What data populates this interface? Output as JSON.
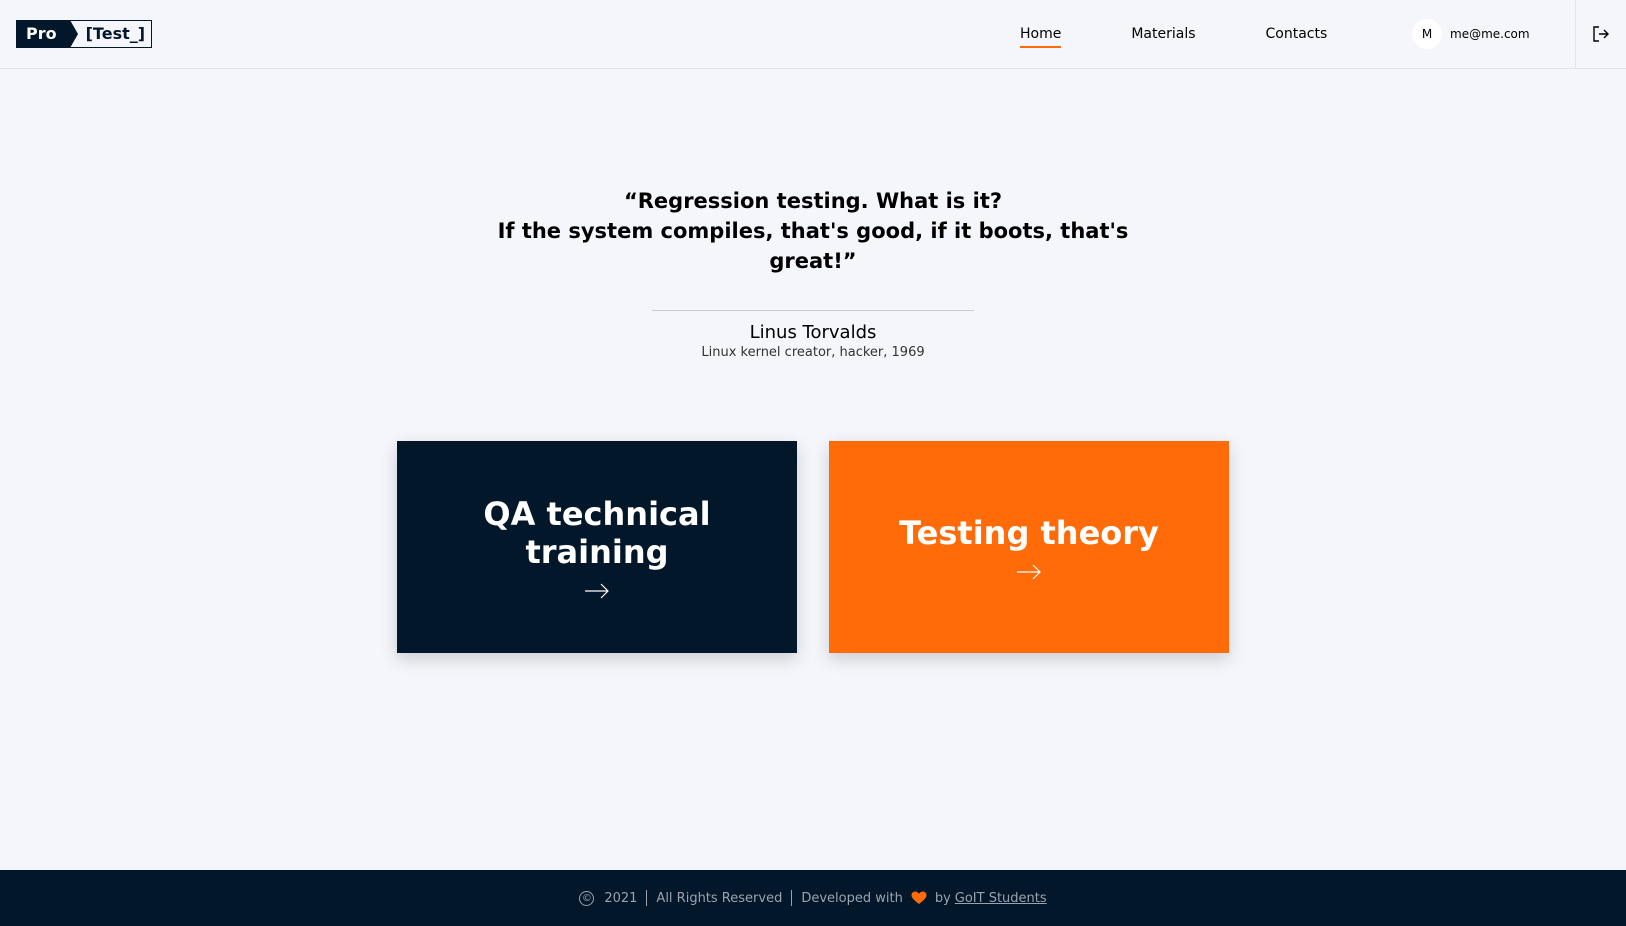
{
  "header": {
    "logo": {
      "left": "Pro",
      "right": "[Test_]"
    },
    "nav": [
      {
        "label": "Home",
        "active": true
      },
      {
        "label": "Materials",
        "active": false
      },
      {
        "label": "Contacts",
        "active": false
      }
    ],
    "user": {
      "initial": "M",
      "email": "me@me.com"
    },
    "logout_icon": "logout-icon"
  },
  "quote": {
    "line1": "“Regression testing. What is it?",
    "line2": "If the system compiles, that's good, if it boots, that's great!”",
    "author": "Linus Torvalds",
    "author_desc": "Linux kernel creator, hacker, 1969"
  },
  "cards": [
    {
      "title": "QA technical training",
      "color": "#02172a",
      "icon": "arrow-right-icon"
    },
    {
      "title": "Testing theory",
      "color": "#ff6b09",
      "icon": "arrow-right-icon"
    }
  ],
  "footer": {
    "year": "2021",
    "rights": "All Rights Reserved",
    "developed": "Developed with",
    "by": "by",
    "link": "GoIT Students",
    "accent": "#ff6b09"
  }
}
